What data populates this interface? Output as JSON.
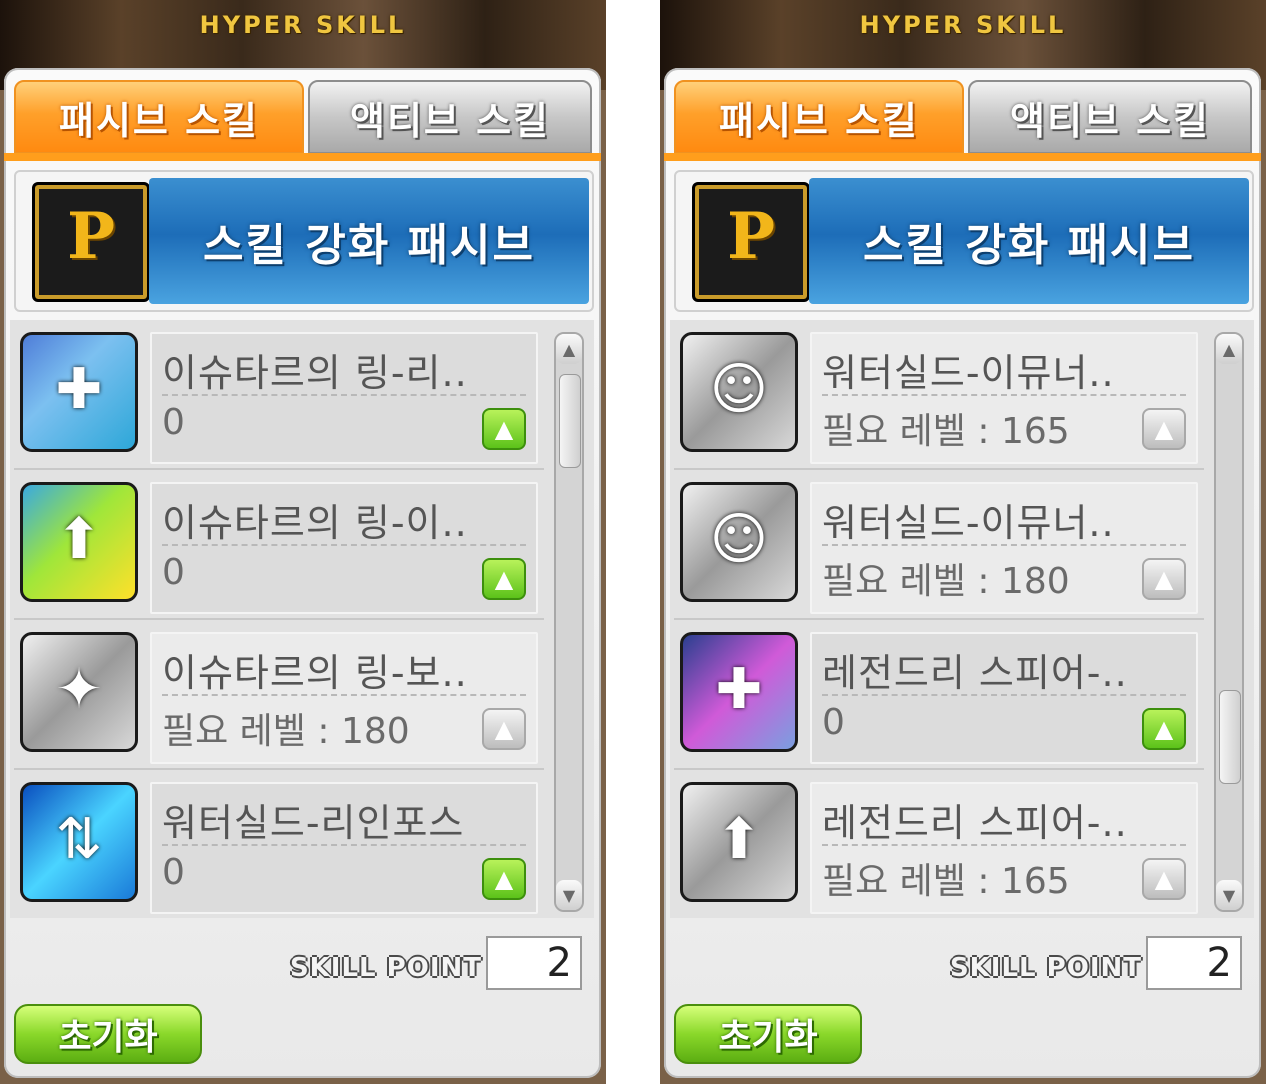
{
  "panels": [
    {
      "title": "HYPER SKILL",
      "tabs": [
        "패시브 스킬",
        "액티브 스킬"
      ],
      "header": "스킬 강화 패시브",
      "header_icon_letter": "P",
      "skills": [
        {
          "name": "이슈타르의 링-리..",
          "level": "0",
          "icon": "ring-reinforce-icon"
        },
        {
          "name": "이슈타르의 링-이..",
          "level": "0",
          "icon": "ring-extra-icon"
        },
        {
          "name": "이슈타르의 링-보..",
          "level": "필요 레벨 : 180",
          "icon": "ring-boss-icon"
        },
        {
          "name": "워터실드-리인포스",
          "level": "0",
          "icon": "watershield-reinforce-icon"
        }
      ],
      "skill_point_label": "SKILL POINT",
      "skill_point": "2",
      "reset_label": "초기화"
    },
    {
      "title": "HYPER SKILL",
      "tabs": [
        "패시브 스킬",
        "액티브 스킬"
      ],
      "header": "스킬 강화 패시브",
      "header_icon_letter": "P",
      "skills": [
        {
          "name": "워터실드-이뮤너..",
          "level": "필요 레벨 : 165",
          "icon": "watershield-immune-icon"
        },
        {
          "name": "워터실드-이뮤너..",
          "level": "필요 레벨 : 180",
          "icon": "watershield-immune-icon"
        },
        {
          "name": "레전드리 스피어-..",
          "level": "0",
          "icon": "legendary-spear-icon"
        },
        {
          "name": "레전드리 스피어-..",
          "level": "필요 레벨 : 165",
          "icon": "legendary-spear-icon"
        }
      ],
      "skill_point_label": "SKILL POINT",
      "skill_point": "2",
      "reset_label": "초기화"
    }
  ]
}
